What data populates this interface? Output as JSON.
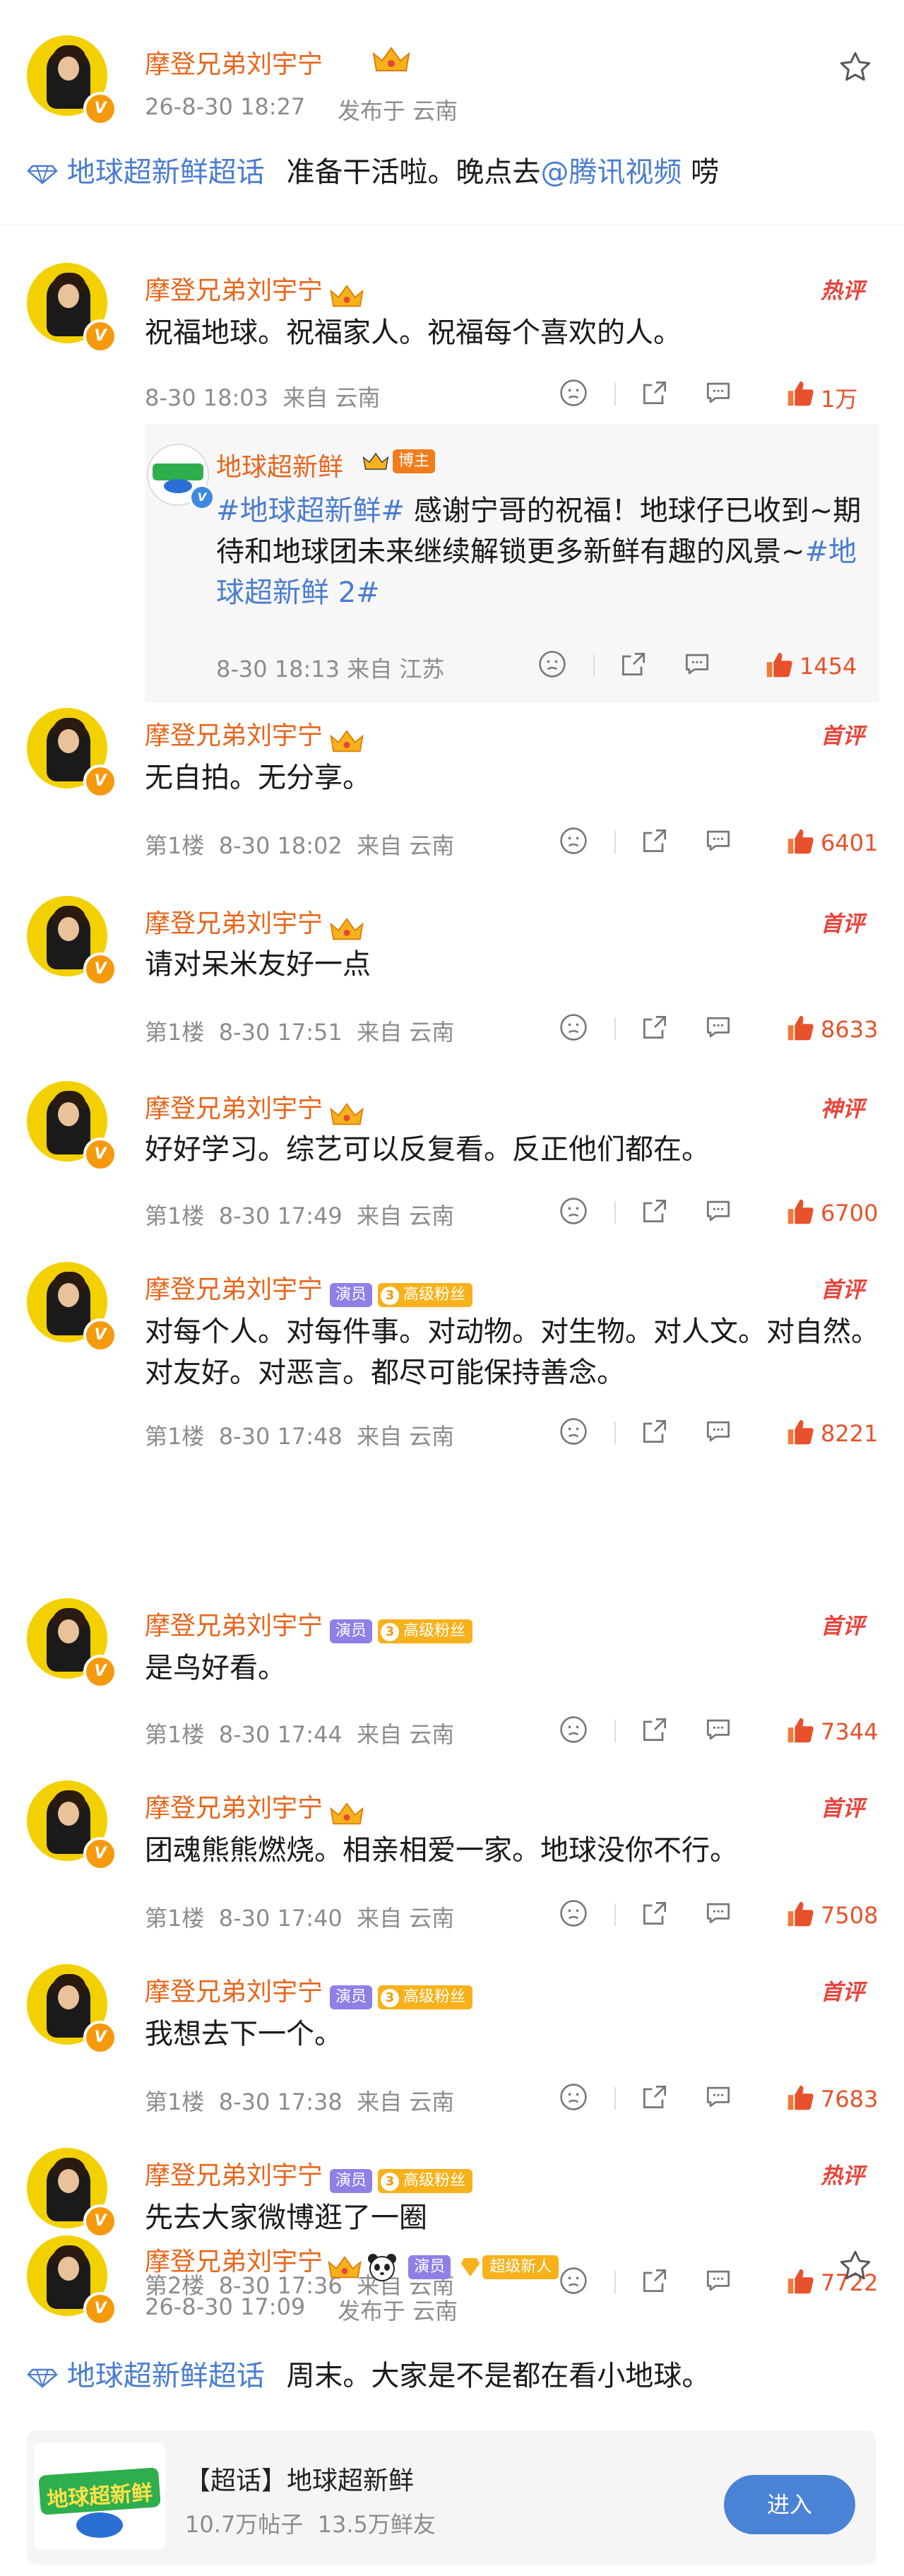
{
  "post1": {
    "author": "摩登兄弟刘宇宁",
    "time": "26-8-30 18:27",
    "published_from": "发布于 云南",
    "topic": "地球超新鲜超话",
    "text_before": "准备干活啦。晚点去",
    "mention": "@腾讯视频",
    "text_after": "唠"
  },
  "comments": [
    {
      "author": "摩登兄弟刘宇宁",
      "badge": "热评",
      "text": "祝福地球。祝福家人。祝福每个喜欢的人。",
      "meta": "8-30 18:03  来自 云南",
      "likes": "1万"
    },
    {
      "author": "摩登兄弟刘宇宁",
      "badge": "首评",
      "text": "无自拍。无分享。",
      "meta": "第1楼  8-30 18:02  来自 云南",
      "likes": "6401"
    },
    {
      "author": "摩登兄弟刘宇宁",
      "badge": "首评",
      "text": "请对呆米友好一点",
      "meta": "第1楼  8-30 17:51  来自 云南",
      "likes": "8633"
    },
    {
      "author": "摩登兄弟刘宇宁",
      "badge": "神评",
      "text": "好好学习。综艺可以反复看。反正他们都在。",
      "meta": "第1楼  8-30 17:49  来自 云南",
      "likes": "6700"
    },
    {
      "author": "摩登兄弟刘宇宁",
      "badge": "首评",
      "text": "对每个人。对每件事。对动物。对生物。对人文。对自然。对友好。对恶言。都尽可能保持善念。",
      "meta": "第1楼  8-30 17:48  来自 云南",
      "likes": "8221"
    },
    {
      "author": "摩登兄弟刘宇宁",
      "badge": "首评",
      "text": "是鸟好看。",
      "meta": "第1楼  8-30 17:44  来自 云南",
      "likes": "7344"
    },
    {
      "author": "摩登兄弟刘宇宁",
      "badge": "首评",
      "text": "团魂熊熊燃烧。相亲相爱一家。地球没你不行。",
      "meta": "第1楼  8-30 17:40  来自 云南",
      "likes": "7508"
    },
    {
      "author": "摩登兄弟刘宇宁",
      "badge": "首评",
      "text": "我想去下一个。",
      "meta": "第1楼  8-30 17:38  来自 云南",
      "likes": "7683"
    },
    {
      "author": "摩登兄弟刘宇宁",
      "badge": "热评",
      "text": "先去大家微博逛了一圈",
      "meta": "第2楼  8-30 17:36  来自 云南",
      "likes": "7722"
    }
  ],
  "reply": {
    "author": "地球超新鲜",
    "host_label": "博主",
    "tag1": "#地球超新鲜#",
    "text": " 感谢宁哥的祝福！地球仔已收到~期待和地球团未来继续解锁更多新鲜有趣的风景~",
    "tag2": "#地球超新鲜 2#",
    "meta": "8-30 18:13  来自 江苏",
    "likes": "1454"
  },
  "chips": {
    "actor": "演员",
    "fan_level": "3",
    "fan": "高级粉丝",
    "new": "超级新人"
  },
  "post2": {
    "author": "摩登兄弟刘宇宁",
    "time": "26-8-30 17:09",
    "published_from": "发布于 云南",
    "topic": "地球超新鲜超话",
    "text": "周末。大家是不是都在看小地球。"
  },
  "supertopic_card": {
    "title": "【超话】地球超新鲜",
    "stats": "10.7万帖子  13.5万鲜友",
    "logo_text": "地球超新鲜",
    "button": "进入"
  },
  "colors": {
    "name": "#e8651b",
    "link": "#4a7dd0",
    "like": "#e8512b",
    "meta": "#8c8c8c"
  }
}
